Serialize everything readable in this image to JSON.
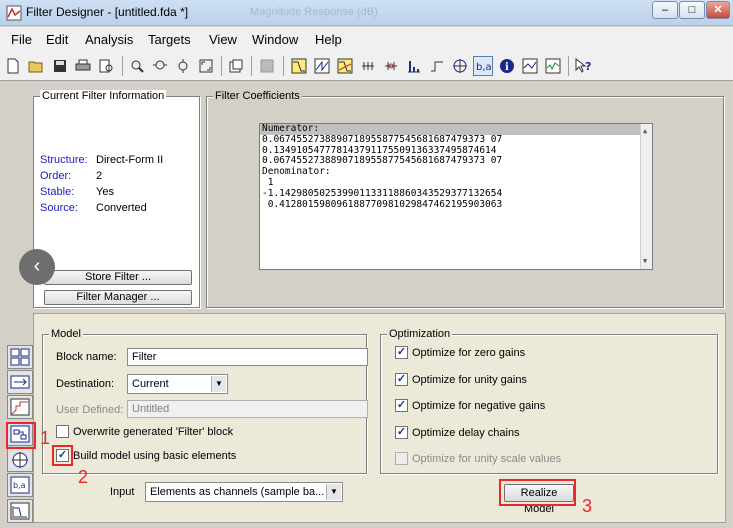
{
  "window": {
    "title": "Filter Designer -  [untitled.fda *]",
    "title_ghost": "Magnitude Response (dB)",
    "minimize": "–",
    "maximize": "□",
    "close": "✕"
  },
  "menu": [
    "File",
    "Edit",
    "Analysis",
    "Targets",
    "View",
    "Window",
    "Help"
  ],
  "toolbar_icons": [
    "new-icon",
    "open-icon",
    "save-icon",
    "print-icon",
    "print-preview-icon",
    "zoom-in-icon",
    "zoom-x-icon",
    "zoom-y-icon",
    "full-view-icon",
    "new-window-icon",
    "legend-icon",
    "magnitude-response-icon",
    "phase-response-icon",
    "magnitude-phase-icon",
    "group-delay-icon",
    "phase-delay-icon",
    "impulse-response-icon",
    "step-response-icon",
    "pole-zero-icon",
    "filter-coefficients-icon",
    "filter-info-icon",
    "magnitude-estimate-icon",
    "round-off-noise-icon",
    "whats-this-icon"
  ],
  "current_filter": {
    "title": "Current Filter Information",
    "rows": [
      {
        "key": "Structure:",
        "value": "Direct-Form II"
      },
      {
        "key": "Order:",
        "value": "2"
      },
      {
        "key": "Stable:",
        "value": "Yes"
      },
      {
        "key": "Source:",
        "value": "Converted"
      }
    ],
    "store_filter": "Store Filter ...",
    "filter_manager": "Filter Manager ..."
  },
  "coefficients": {
    "title": "Filter Coefficients",
    "lines": [
      "Numerator:",
      "0.0674552738890718955877545681687479373 07",
      "0.134910547778143791175509136337495874614",
      "0.0674552738890718955877545681687479373 07",
      "Denominator:",
      " 1",
      "-1.142980502539901133118860343529377132654",
      " 0.412801598096188770981029847462195903063"
    ]
  },
  "model": {
    "title": "Model",
    "block_name_label": "Block name:",
    "block_name_value": "Filter",
    "destination_label": "Destination:",
    "destination_value": "Current",
    "user_defined_label": "User Defined:",
    "user_defined_value": "Untitled",
    "overwrite_label": "Overwrite generated 'Filter' block",
    "basic_elements_label": "Build model using basic elements",
    "input_label": "Input",
    "input_value": "Elements as channels (sample ba...",
    "realize_button": "Realize Model"
  },
  "optimization": {
    "title": "Optimization",
    "items": [
      {
        "label": "Optimize for zero gains",
        "checked": true
      },
      {
        "label": "Optimize for unity gains",
        "checked": true
      },
      {
        "label": "Optimize for negative gains",
        "checked": true
      },
      {
        "label": "Optimize delay chains",
        "checked": true
      },
      {
        "label": "Optimize for unity scale values",
        "checked": false
      }
    ]
  },
  "annotations": [
    "1",
    "2",
    "3"
  ],
  "colors": {
    "annotation": "#e8282a",
    "info_key": "#1a1acc"
  }
}
